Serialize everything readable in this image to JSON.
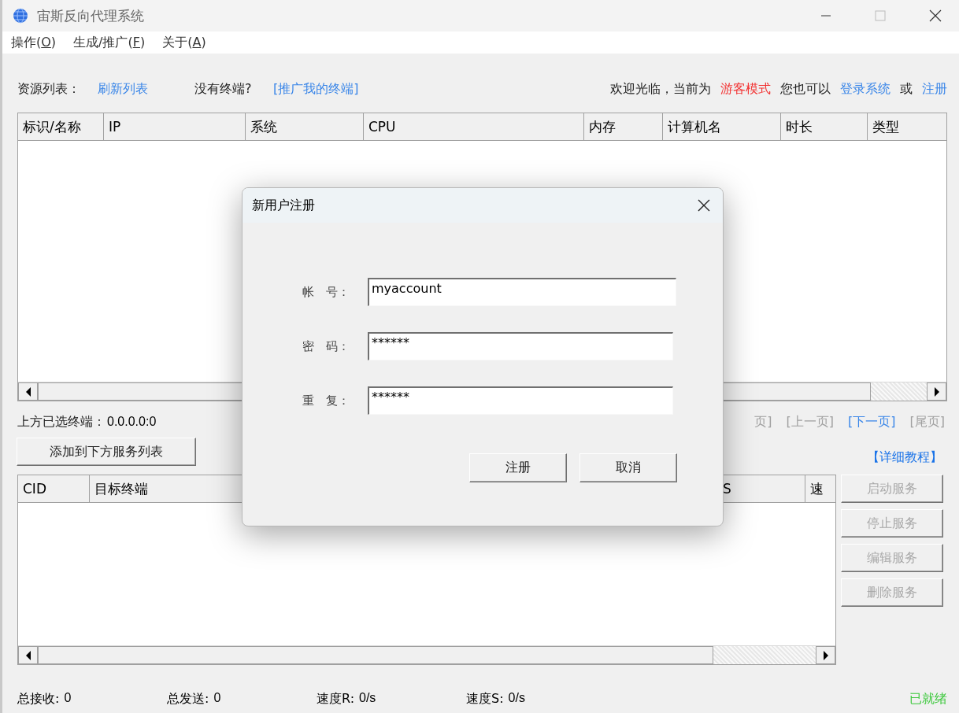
{
  "window": {
    "title": "宙斯反向代理系统"
  },
  "menu": [
    {
      "before": "操作(",
      "key": "O",
      "after": ")"
    },
    {
      "before": "生成/推广(",
      "key": "F",
      "after": ")"
    },
    {
      "before": "关于(",
      "key": "A",
      "after": ")"
    }
  ],
  "toolbar": {
    "items": [
      {
        "kind": "label",
        "text": "资源列表："
      },
      {
        "kind": "link",
        "text": "刷新列表"
      },
      {
        "kind": "label",
        "text": "没有终端?"
      },
      {
        "kind": "link",
        "text": "[推广我的终端]"
      }
    ],
    "welcome": [
      {
        "kind": "label",
        "text": "欢迎光临，当前为"
      },
      {
        "kind": "status",
        "text": "游客模式"
      },
      {
        "kind": "label",
        "text": "您也可以"
      },
      {
        "kind": "link",
        "text": "登录系统"
      },
      {
        "kind": "label",
        "text": "或"
      },
      {
        "kind": "link",
        "text": "注册"
      }
    ]
  },
  "terminal_table": {
    "columns": [
      "标识/名称",
      "IP",
      "系统",
      "CPU",
      "内存",
      "计算机名",
      "时长",
      "类型"
    ]
  },
  "selected_terminal": {
    "label": "上方已选终端：",
    "value": "0.0.0.0:0"
  },
  "pager": [
    {
      "text": "页]",
      "disabled": true
    },
    {
      "text": "[上一页]",
      "disabled": true
    },
    {
      "text": "[下一页]",
      "disabled": false
    },
    {
      "text": "[尾页]",
      "disabled": true
    }
  ],
  "add_button": "添加到下方服务列表",
  "tutorial_link": "【详细教程】",
  "service_table": {
    "columns": [
      "CID",
      "目标终端",
      "S",
      "速"
    ]
  },
  "service_buttons": [
    {
      "label": "启动服务",
      "disabled": true
    },
    {
      "label": "停止服务",
      "disabled": true
    },
    {
      "label": "编辑服务",
      "disabled": true
    },
    {
      "label": "删除服务",
      "disabled": true
    }
  ],
  "status_bar": {
    "stats": [
      {
        "label": "总接收:",
        "value": "0"
      },
      {
        "label": "总发送:",
        "value": "0"
      },
      {
        "label": "速度R:",
        "value": "0/s"
      },
      {
        "label": "速度S:",
        "value": "0/s"
      }
    ],
    "state": "已就绪"
  },
  "dialog": {
    "title": "新用户注册",
    "fields": [
      {
        "label": "帐　号：",
        "value": "myaccount"
      },
      {
        "label": "密　码：",
        "value": "******"
      },
      {
        "label": "重　复：",
        "value": "******"
      }
    ],
    "buttons": [
      "注册",
      "取消"
    ]
  }
}
